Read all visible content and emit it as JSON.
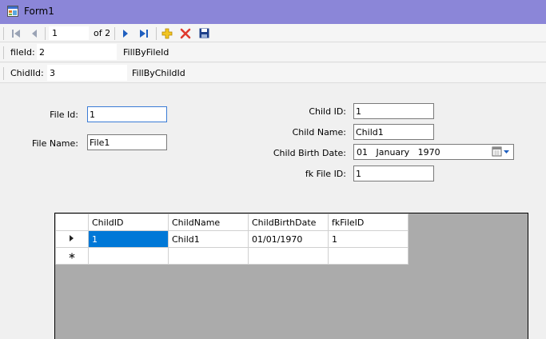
{
  "window": {
    "title": "Form1",
    "icon": "winforms-app-icon"
  },
  "binding_navigator": {
    "position": "1",
    "count_label": "of 2",
    "buttons": [
      "move-first-icon",
      "move-previous-icon",
      "move-next-icon",
      "move-last-icon",
      "add-new-icon",
      "delete-icon",
      "save-icon"
    ]
  },
  "fill_by_file": {
    "label": "fileId:",
    "value": "2",
    "button": "FillByFileId"
  },
  "fill_by_child": {
    "label": "ChidlId:",
    "value": "3",
    "button": "FillByChildId"
  },
  "file_form": {
    "file_id_label": "File Id:",
    "file_id_value": "1",
    "file_name_label": "File Name:",
    "file_name_value": "File1"
  },
  "child_form": {
    "child_id_label": "Child ID:",
    "child_id_value": "1",
    "child_name_label": "Child Name:",
    "child_name_value": "Child1",
    "birth_label": "Child Birth Date:",
    "birth_value": "01   January   1970",
    "fk_label": "fk File ID:",
    "fk_value": "1"
  },
  "grid": {
    "columns": [
      "ChildID",
      "ChildName",
      "ChildBirthDate",
      "fkFileID"
    ],
    "rows": [
      {
        "indicator": "current-row-arrow-icon",
        "cells": [
          "1",
          "Child1",
          "01/01/1970",
          "1"
        ]
      },
      {
        "indicator": "new-row-star-icon",
        "cells": [
          "",
          "",
          "",
          ""
        ]
      }
    ]
  }
}
